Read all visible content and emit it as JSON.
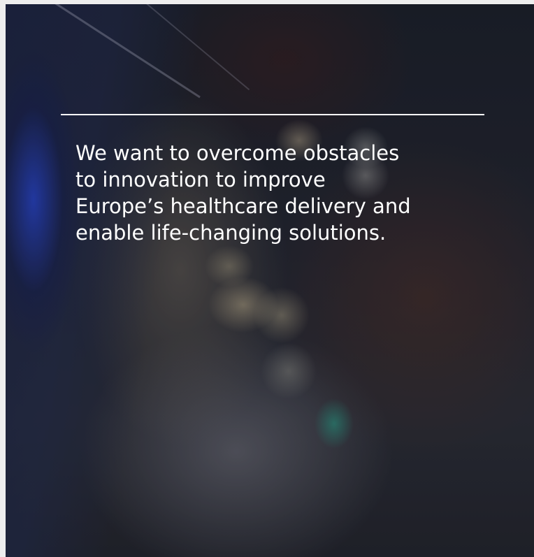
{
  "hero": {
    "statement": "We want to overcome obstacles\nto innovation to improve\nEurope’s healthcare delivery and\nenable life-changing solutions."
  },
  "colors": {
    "text": "#ffffff",
    "rule": "#ffffff",
    "background_dark": "#1c2029",
    "tablet_glow": "#2846d2",
    "accent_teal": "#28b496"
  }
}
